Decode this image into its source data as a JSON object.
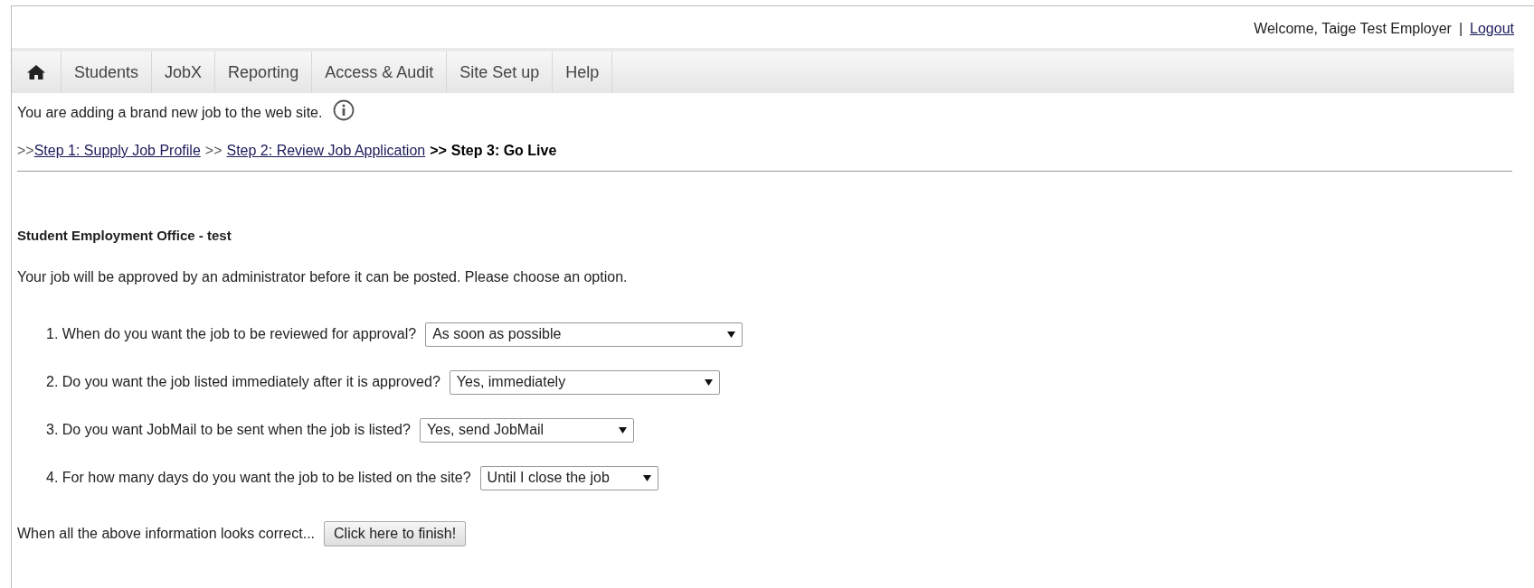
{
  "header": {
    "welcome": "Welcome, Taige Test Employer",
    "separator": "|",
    "logout": "Logout"
  },
  "nav": {
    "items": [
      {
        "kind": "home"
      },
      {
        "kind": "text",
        "label": "Students"
      },
      {
        "kind": "text",
        "label": "JobX"
      },
      {
        "kind": "text",
        "label": "Reporting"
      },
      {
        "kind": "text",
        "label": "Access & Audit"
      },
      {
        "kind": "text",
        "label": "Site Set up"
      },
      {
        "kind": "text",
        "label": "Help"
      }
    ]
  },
  "intro": "You are adding a brand new job to the web site.",
  "steps": [
    {
      "prefix": ">>",
      "label": "Step 1: Supply Job Profile",
      "current": false
    },
    {
      "prefix": ">>",
      "label": "Step 2: Review Job Application",
      "current": false
    },
    {
      "prefix": ">>",
      "label": "Step 3: Go Live",
      "current": true
    }
  ],
  "office": "Student Employment Office - test",
  "instruction": "Your job will be approved by an administrator before it can be posted. Please choose an option.",
  "questions": [
    {
      "label": "1. When do you want the job to be reviewed for approval?",
      "value": "As soon as possible"
    },
    {
      "label": "2. Do you want the job listed immediately after it is approved?",
      "value": "Yes, immediately"
    },
    {
      "label": "3. Do you want JobMail to be sent when the job is listed?",
      "value": "Yes, send JobMail"
    },
    {
      "label": "4. For how many days do you want the job to be listed on the site?",
      "value": "Until I close the job"
    }
  ],
  "finish": {
    "label": "When all the above information looks correct...",
    "button": "Click here to finish!"
  }
}
